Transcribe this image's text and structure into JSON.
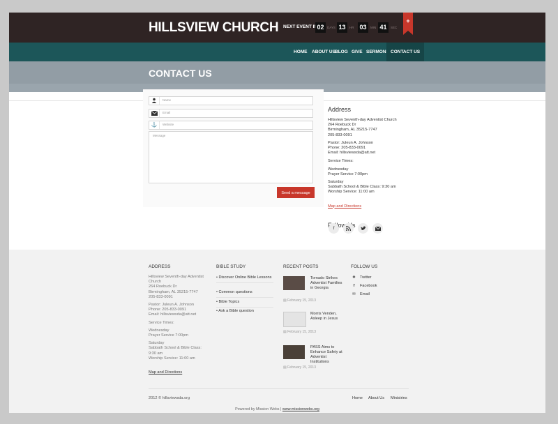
{
  "site": {
    "title": "HILLSVIEW CHURCH"
  },
  "countdown": {
    "label": "NEXT EVENT IN:",
    "days": "02",
    "days_unit": "DAYS",
    "hours": "13",
    "hours_unit": "HR",
    "minutes": "03",
    "minutes_unit": "MIN",
    "seconds": "41",
    "seconds_unit": "SEC",
    "ribbon": "+"
  },
  "nav": {
    "items": [
      "HOME",
      "ABOUT US",
      "BLOG",
      "GIVE",
      "SERMONS",
      "CONTACT US"
    ],
    "active": "CONTACT US"
  },
  "page": {
    "title": "CONTACT US"
  },
  "form": {
    "name_placeholder": "Name",
    "email_placeholder": "Email",
    "website_placeholder": "Website",
    "message_placeholder": "Message",
    "send_label": "Send a message",
    "icons": {
      "name": "user-icon",
      "email": "envelope-icon",
      "website": "anchor-icon"
    }
  },
  "address": {
    "heading": "Address",
    "line1": "Hillsview Seventh-day Adventist Church",
    "line2": "264 Roebuck Dr",
    "line3": "Birmingham, AL 35215-7747",
    "line4": "205-833-0091",
    "pastor": "Pastor: Juleun A. Johnson",
    "phone": "Phone: 205-833-0091",
    "email": "Email: hillsviewsda@att.net",
    "service_times": "Service Times:",
    "wednesday": "Wednesday",
    "prayer": "Prayer Service 7:00pm",
    "saturday": "Saturday",
    "sabbath": "Sabbath School & Bible Class: 9:30 am",
    "worship": "Worship Service: 11:00 am",
    "map_link": "Map and Directions"
  },
  "follow": {
    "heading": "Follow Us",
    "icons": [
      "facebook-icon",
      "rss-icon",
      "twitter-icon",
      "email-icon"
    ]
  },
  "footer": {
    "address": {
      "heading": "ADDRESS",
      "line1": "Hillsview Seventh-day Adventist Church",
      "line2": "264 Roebuck Dr",
      "line3": "Birmingham, AL 35215-7747",
      "line4": "205-833-0091",
      "pastor": "Pastor: Juleun A. Johnson",
      "phone": "Phone: 205-833-0091",
      "email": "Email: hillsviewsda@att.net",
      "service_times": "Service Times:",
      "wednesday": "Wednesday",
      "prayer": "Prayer Service 7:00pm",
      "saturday": "Saturday",
      "sabbath": "Sabbath School & Bible Class: 9:30 am",
      "worship": "Worship Service: 11:00 am",
      "map_link": "Map and Directions"
    },
    "bible_study": {
      "heading": "BIBLE STUDY",
      "items": [
        "Discover Online Bible Lessons",
        "Common questions",
        "Bible Topics",
        "Ask a Bible question"
      ]
    },
    "recent_posts": {
      "heading": "RECENT POSTS",
      "posts": [
        {
          "title": "Tornado Strikes Adventist Families in Georgia",
          "date": "February 15, 2013"
        },
        {
          "title": "Morris Venden, Asleep in Jesus",
          "date": "February 15, 2013"
        },
        {
          "title": "PASS Aims to Enhance Safety at Adventist Institutions",
          "date": "February 15, 2013"
        }
      ]
    },
    "follow": {
      "heading": "FOLLOW US",
      "items": [
        {
          "label": "Twitter",
          "icon": "twitter-icon"
        },
        {
          "label": "Facebook",
          "icon": "facebook-icon"
        },
        {
          "label": "Email",
          "icon": "email-icon"
        }
      ]
    },
    "copyright": "2012 © hillsviewsda.org",
    "nav": [
      "Home",
      "About Us",
      "Ministries"
    ],
    "powered_prefix": "Powered by Mission Webs |",
    "powered_link": "www.missionwebs.org"
  },
  "colors": {
    "accent": "#c8372b",
    "topbar": "#2f2424",
    "nav": "#1c5659",
    "header_band": "#929da5"
  }
}
